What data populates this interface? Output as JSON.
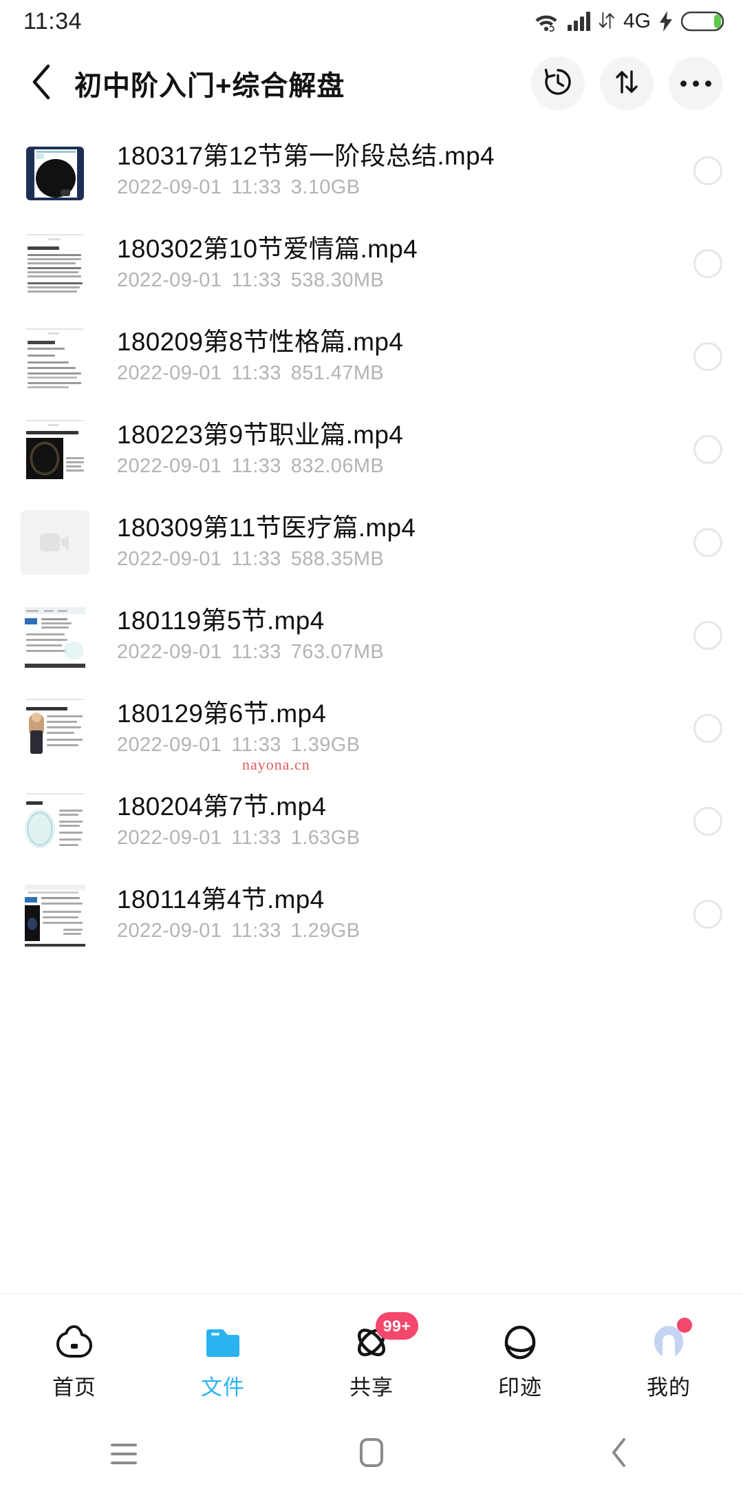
{
  "status_bar": {
    "time": "11:34",
    "network_label": "4G",
    "icons": [
      "wifi-icon",
      "signal-icon",
      "data-transfer-icon",
      "charging-icon",
      "battery-icon"
    ]
  },
  "header": {
    "back_icon": "chevron-left-icon",
    "title": "初中阶入门+综合解盘",
    "actions": [
      {
        "name": "history-button",
        "icon": "history-clock-icon"
      },
      {
        "name": "sort-button",
        "icon": "sort-arrows-icon"
      },
      {
        "name": "more-button",
        "icon": "more-dots-icon"
      }
    ]
  },
  "files": [
    {
      "name": "180317第12节第一阶段总结.mp4",
      "date": "2022-09-01",
      "time": "11:33",
      "size": "3.10GB",
      "thumb": "chart-dark"
    },
    {
      "name": "180302第10节爱情篇.mp4",
      "date": "2022-09-01",
      "time": "11:33",
      "size": "538.30MB",
      "thumb": "doc-text"
    },
    {
      "name": "180209第8节性格篇.mp4",
      "date": "2022-09-01",
      "time": "11:33",
      "size": "851.47MB",
      "thumb": "doc-list"
    },
    {
      "name": "180223第9节职业篇.mp4",
      "date": "2022-09-01",
      "time": "11:33",
      "size": "832.06MB",
      "thumb": "chart-black"
    },
    {
      "name": "180309第11节医疗篇.mp4",
      "date": "2022-09-01",
      "time": "11:33",
      "size": "588.35MB",
      "thumb": "video-placeholder"
    },
    {
      "name": "180119第5节.mp4",
      "date": "2022-09-01",
      "time": "11:33",
      "size": "763.07MB",
      "thumb": "doc-blue"
    },
    {
      "name": "180129第6节.mp4",
      "date": "2022-09-01",
      "time": "11:33",
      "size": "1.39GB",
      "thumb": "doc-person"
    },
    {
      "name": "180204第7节.mp4",
      "date": "2022-09-01",
      "time": "11:33",
      "size": "1.63GB",
      "thumb": "doc-teal"
    },
    {
      "name": "180114第4节.mp4",
      "date": "2022-09-01",
      "time": "11:33",
      "size": "1.29GB",
      "thumb": "doc-dark"
    }
  ],
  "watermark": {
    "text": "nayona.cn",
    "color": "#e05b5b"
  },
  "tabbar": {
    "active_color": "#2bb3ef",
    "items": [
      {
        "label": "首页",
        "icon": "cloud-icon",
        "active": false,
        "badge": null,
        "dot": false
      },
      {
        "label": "文件",
        "icon": "folder-icon",
        "active": true,
        "badge": null,
        "dot": false
      },
      {
        "label": "共享",
        "icon": "share-atom-icon",
        "active": false,
        "badge": "99+",
        "dot": false
      },
      {
        "label": "印迹",
        "icon": "planet-icon",
        "active": false,
        "badge": null,
        "dot": false
      },
      {
        "label": "我的",
        "icon": "profile-icon",
        "active": false,
        "badge": null,
        "dot": true
      }
    ]
  },
  "android_nav": [
    {
      "name": "recents-key",
      "icon": "hamburger-icon"
    },
    {
      "name": "home-key",
      "icon": "rounded-square-icon"
    },
    {
      "name": "back-key",
      "icon": "chevron-left-icon"
    }
  ]
}
